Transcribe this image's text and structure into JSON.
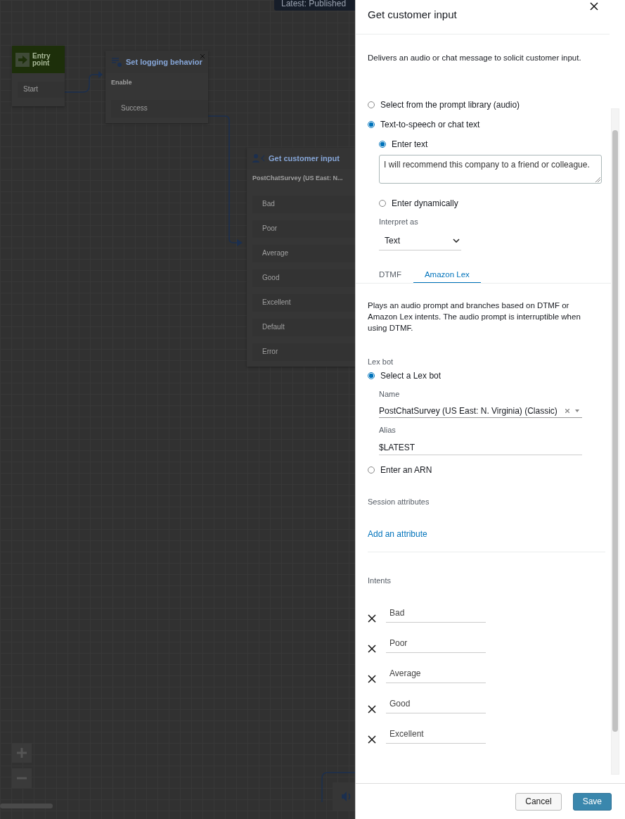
{
  "canvas": {
    "version_badge": "Latest: Published",
    "nodes": [
      {
        "kind": "entry",
        "title": "Entry point",
        "branches": [
          "Start"
        ]
      },
      {
        "kind": "block",
        "title": "Set logging behavior",
        "subtitle": "Enable",
        "branches": [
          "Success"
        ]
      },
      {
        "kind": "block",
        "title": "Get customer input",
        "subtitle": "PostChatSurvey (US East: N...",
        "branches": [
          "Bad",
          "Poor",
          "Average",
          "Good",
          "Excellent",
          "Default",
          "Error"
        ]
      }
    ]
  },
  "panel": {
    "title": "Get customer input",
    "description": "Delivers an audio or chat message to solicit customer input.",
    "prompt_options": [
      {
        "label": "Select from the prompt library (audio)",
        "selected": false
      },
      {
        "label": "Text-to-speech or chat text",
        "selected": true
      }
    ],
    "text_options": [
      {
        "label": "Enter text",
        "selected": true
      },
      {
        "label": "Enter dynamically",
        "selected": false
      }
    ],
    "text_value": "I will recommend this company to a friend or colleague.",
    "interpret_label": "Interpret as",
    "interpret_value": "Text",
    "tabs": [
      {
        "label": "DTMF",
        "selected": false
      },
      {
        "label": "Amazon Lex",
        "selected": true
      }
    ],
    "tab_description": "Plays an audio prompt and branches based on DTMF or Amazon Lex intents. The audio prompt is interruptible when using DTMF.",
    "lex_bot_label": "Lex bot",
    "lex_options": [
      {
        "label": "Select a Lex bot",
        "selected": true
      },
      {
        "label": "Enter an ARN",
        "selected": false
      }
    ],
    "name_label": "Name",
    "name_value": "PostChatSurvey (US East: N. Virginia) (Classic)",
    "alias_label": "Alias",
    "alias_value": "$LATEST",
    "session_label": "Session attributes",
    "add_attribute": "Add an attribute",
    "intents_label": "Intents",
    "intents": [
      "Bad",
      "Poor",
      "Average",
      "Good",
      "Excellent"
    ],
    "buttons": {
      "cancel": "Cancel",
      "save": "Save"
    }
  }
}
